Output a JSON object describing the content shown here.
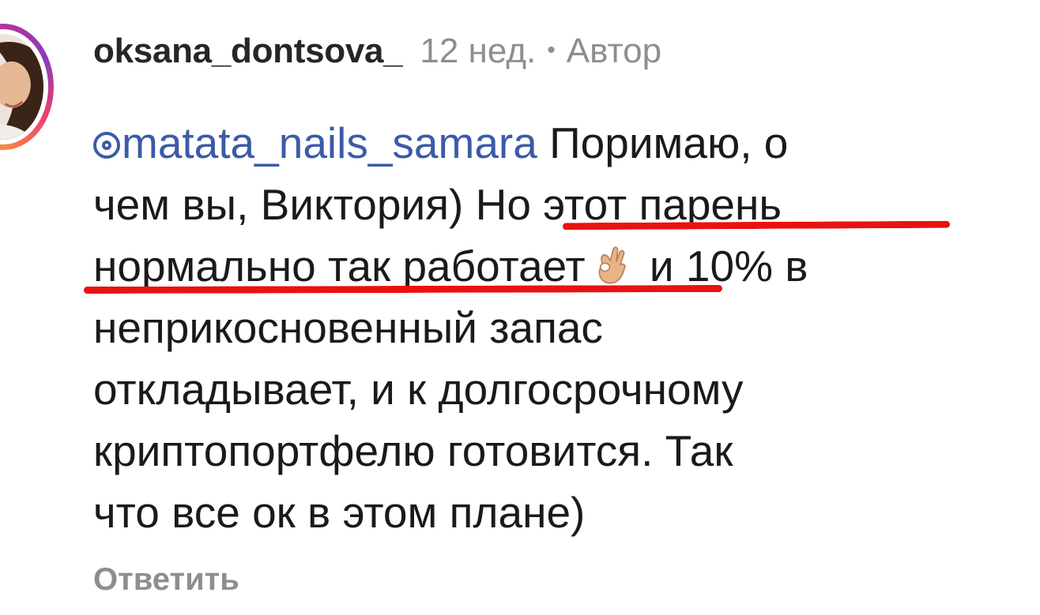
{
  "comment": {
    "username": "oksana_dontsova_",
    "time_ago": "12 нед.",
    "separator": "•",
    "author_badge": "Автор",
    "mention": "matata_nails_samara",
    "lines": [
      " Поримаю, о",
      "чем вы, Виктория) ",
      "Но этот парень",
      "нормально так работает",
      " и 10% в",
      "неприкосновенный запас",
      "откладывает, и к долгосрочному",
      "криптопортфелю готовится. Так",
      "что все ок в этом плане)"
    ],
    "emoji": "ok-hand-emoji",
    "reply_label": "Ответить"
  },
  "annotations": {
    "underline_color": "#ea1111"
  },
  "colors": {
    "mention": "#3b5ba8",
    "meta": "#8e8e8e"
  }
}
